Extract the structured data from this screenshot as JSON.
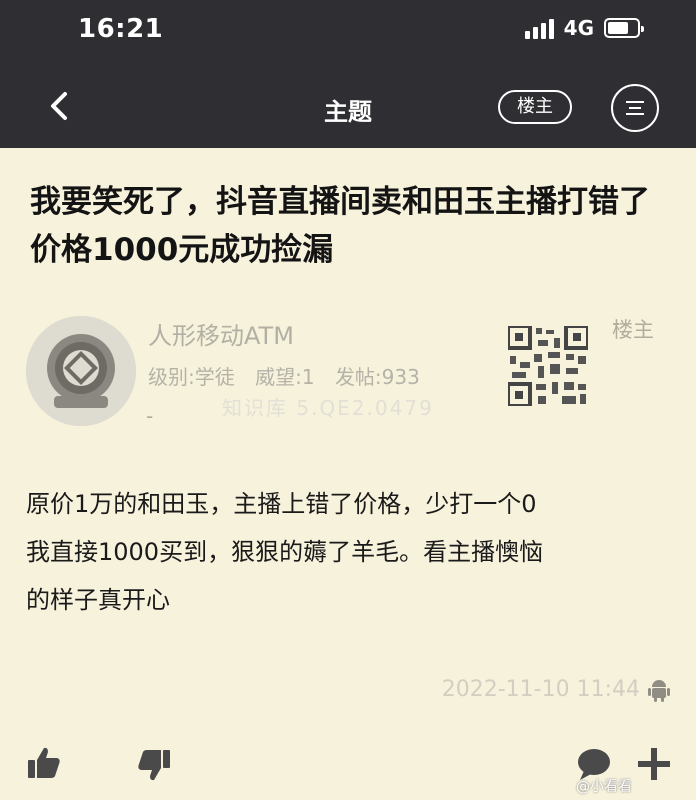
{
  "status_bar": {
    "time": "16:21",
    "network": "4G",
    "signal_icon": "signal-bars-icon",
    "battery_icon": "battery-icon"
  },
  "nav": {
    "back_icon": "chevron-left-icon",
    "title": "主题",
    "louzhu_label": "楼主",
    "menu_icon": "menu-icon"
  },
  "post": {
    "title": "我要笑死了，抖音直播间卖和田玉主播打错了价格1000元成功捡漏",
    "author": {
      "name": "人形移动ATM",
      "level_label": "级别:学徒",
      "reputation_label": "威望:1",
      "posts_label": "发帖:933",
      "dash": "-",
      "role_tag": "楼主",
      "avatar_icon": "diving-helmet-avatar",
      "qr_icon": "qr-code-icon"
    },
    "watermark": "知识库 5.QE2.0479",
    "body_lines": [
      "原价1万的和田玉，主播上错了价格，少打一个0",
      "我直接1000买到，狠狠的薅了羊毛。看主播懊恼",
      "的样子真开心"
    ],
    "timestamp": "2022-11-10 11:44",
    "device_icon": "android-icon"
  },
  "actions": {
    "like_icon": "thumbs-up-icon",
    "dislike_icon": "thumbs-down-icon",
    "comment_icon": "comment-icon",
    "add_icon": "plus-icon"
  },
  "overlay": {
    "weibo_credit": "@小看看"
  },
  "colors": {
    "header_bg": "#2f2f33",
    "page_bg": "#f7f2dc",
    "title_text": "#141414",
    "muted_text": "#b2b0a5"
  }
}
